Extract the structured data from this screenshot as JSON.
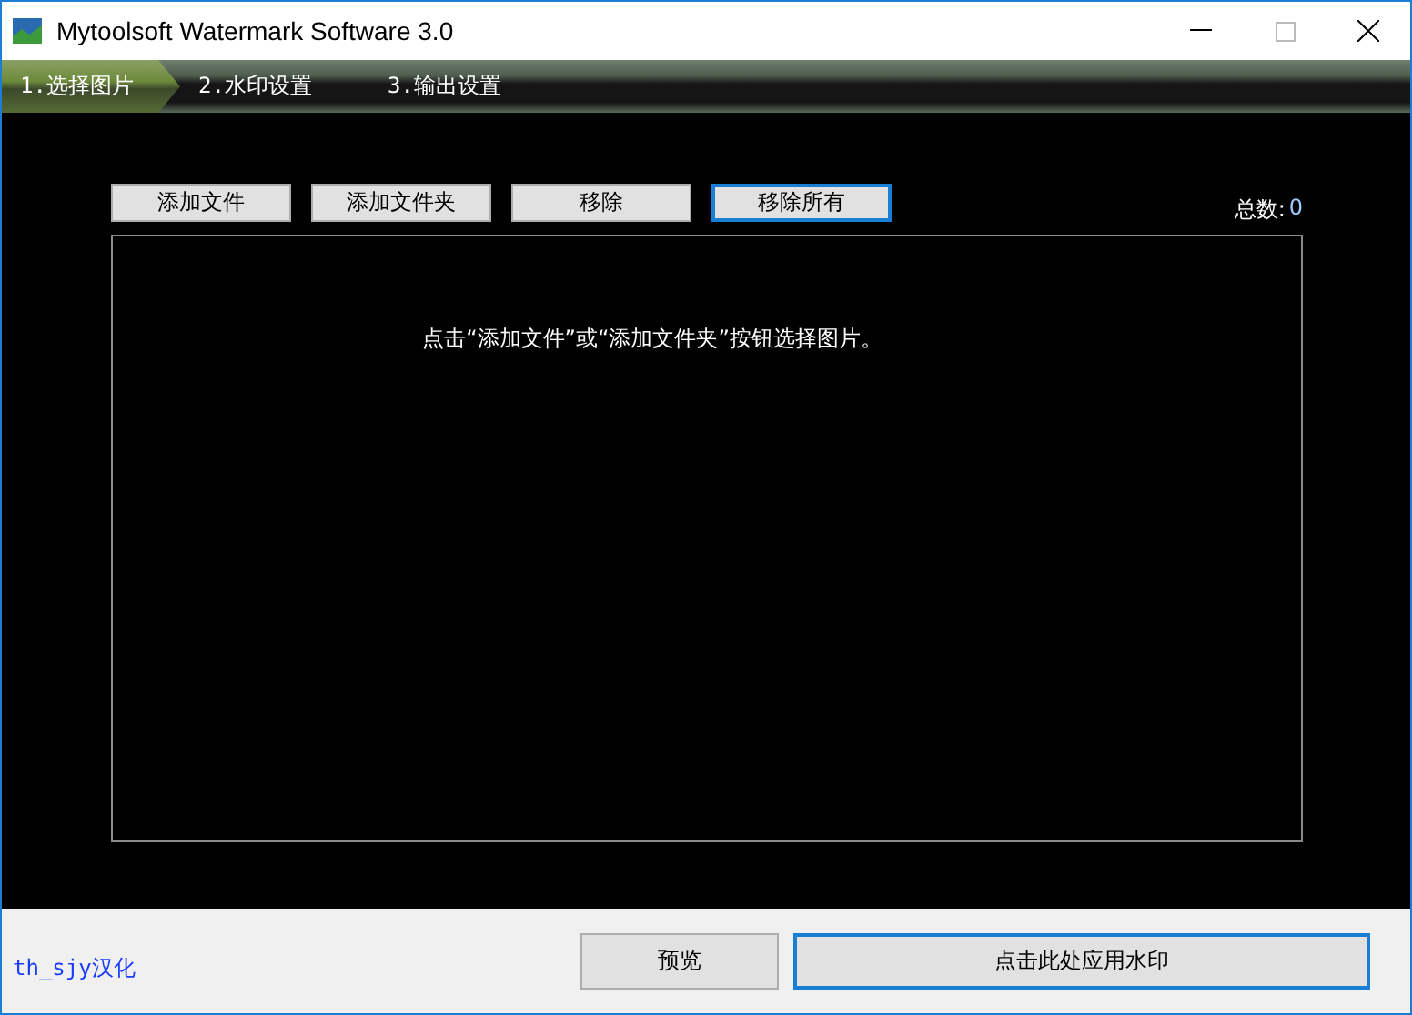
{
  "window": {
    "title": "Mytoolsoft Watermark Software 3.0"
  },
  "tabs": [
    {
      "label": "1.选择图片",
      "selected": true
    },
    {
      "label": "2.水印设置",
      "selected": false
    },
    {
      "label": "3.输出设置",
      "selected": false
    }
  ],
  "toolbar": [
    {
      "label": "添加文件",
      "focused": false
    },
    {
      "label": "添加文件夹",
      "focused": false
    },
    {
      "label": "移除",
      "focused": false
    },
    {
      "label": "移除所有",
      "focused": true
    }
  ],
  "total": {
    "label": "总数:",
    "value": "0"
  },
  "file_list": {
    "hint": "点击“添加文件”或“添加文件夹”按钮选择图片。"
  },
  "footer": {
    "credit": "th_sjy汉化",
    "buttons": [
      {
        "label": "预览",
        "focused": false
      },
      {
        "label": "点击此处应用水印",
        "focused": true
      }
    ]
  }
}
